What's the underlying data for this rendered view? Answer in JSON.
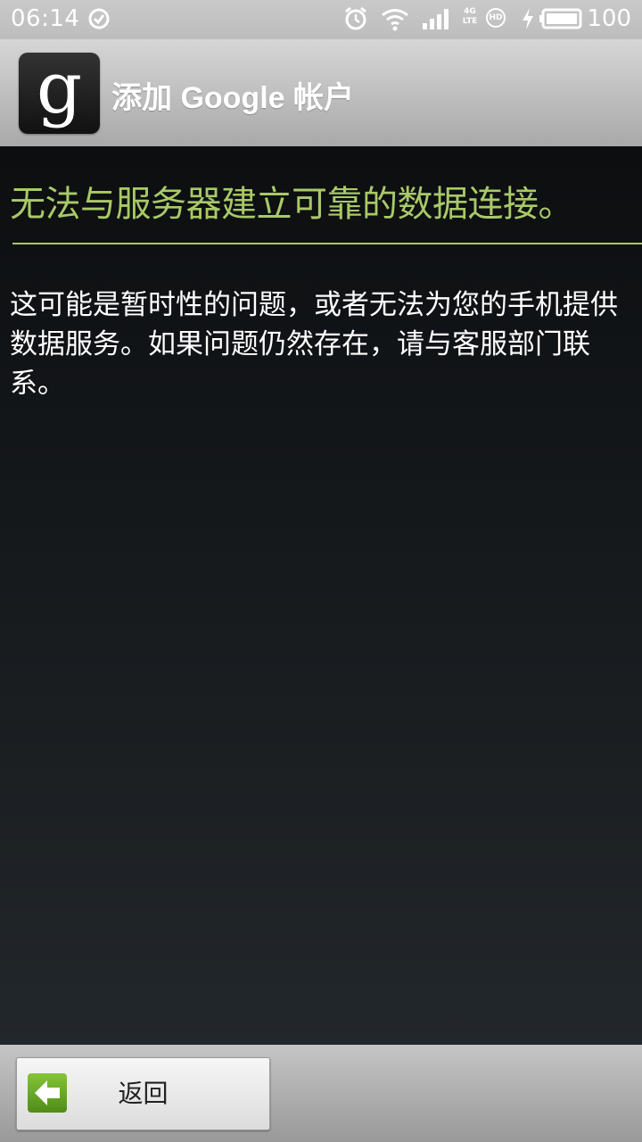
{
  "status_bar": {
    "time": "06:14",
    "network_label": "4G LTE",
    "hd_label": "HD",
    "battery_percent": "100",
    "icons": [
      "check-circle-icon",
      "alarm-icon",
      "wifi-icon",
      "signal-icon",
      "hd-icon",
      "charging-icon",
      "battery-icon"
    ]
  },
  "header": {
    "title": "添加 Google 帐户",
    "app_icon_letter": "g"
  },
  "main": {
    "error_title": "无法与服务器建立可靠的数据连接。",
    "message": "这可能是暂时性的问题，或者无法为您的手机提供数据服务。如果问题仍然存在，请与客服部门联系。"
  },
  "footer": {
    "back_label": "返回"
  },
  "colors": {
    "accent": "#a9c968",
    "button_icon": "#6fae2a"
  }
}
